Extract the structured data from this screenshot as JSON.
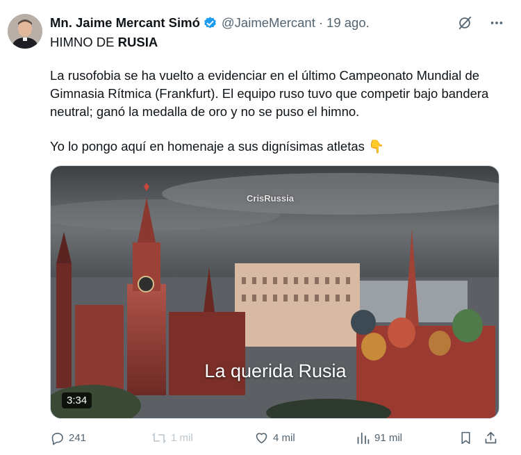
{
  "tweet": {
    "author_name": "Mn. Jaime Mercant Simó",
    "handle": "@JaimeMercant",
    "separator": "·",
    "date": "19 ago.",
    "headline_plain": "HIMNO DE ",
    "headline_bold": "RUSIA",
    "paragraph": "La rusofobia se ha vuelto a evidenciar en el último Campeonato Mundial de Gimnasia Rítmica (Frankfurt). El equipo ruso tuvo que competir bajo bandera neutral; ganó la medalla de oro y no se puso el himno.",
    "closing": "Yo lo pongo aquí en homenaje a sus dignísimas atletas 👇"
  },
  "media": {
    "watermark": "CrisRussia",
    "caption": "La querida Rusia",
    "duration": "3:34"
  },
  "actions": {
    "replies": "241",
    "reposts": "1 mil",
    "likes": "4 mil",
    "views": "91 mil"
  },
  "icons": {
    "verified": "verified-badge-icon",
    "grok": "grok-icon",
    "more": "more-icon",
    "reply": "reply-icon",
    "repost": "repost-icon",
    "like": "heart-icon",
    "views": "views-icon",
    "bookmark": "bookmark-icon",
    "share": "share-icon"
  },
  "colors": {
    "verified_blue": "#1d9bf0",
    "text": "#0f1419",
    "muted": "#536471",
    "disabled": "#b9c4cc"
  }
}
